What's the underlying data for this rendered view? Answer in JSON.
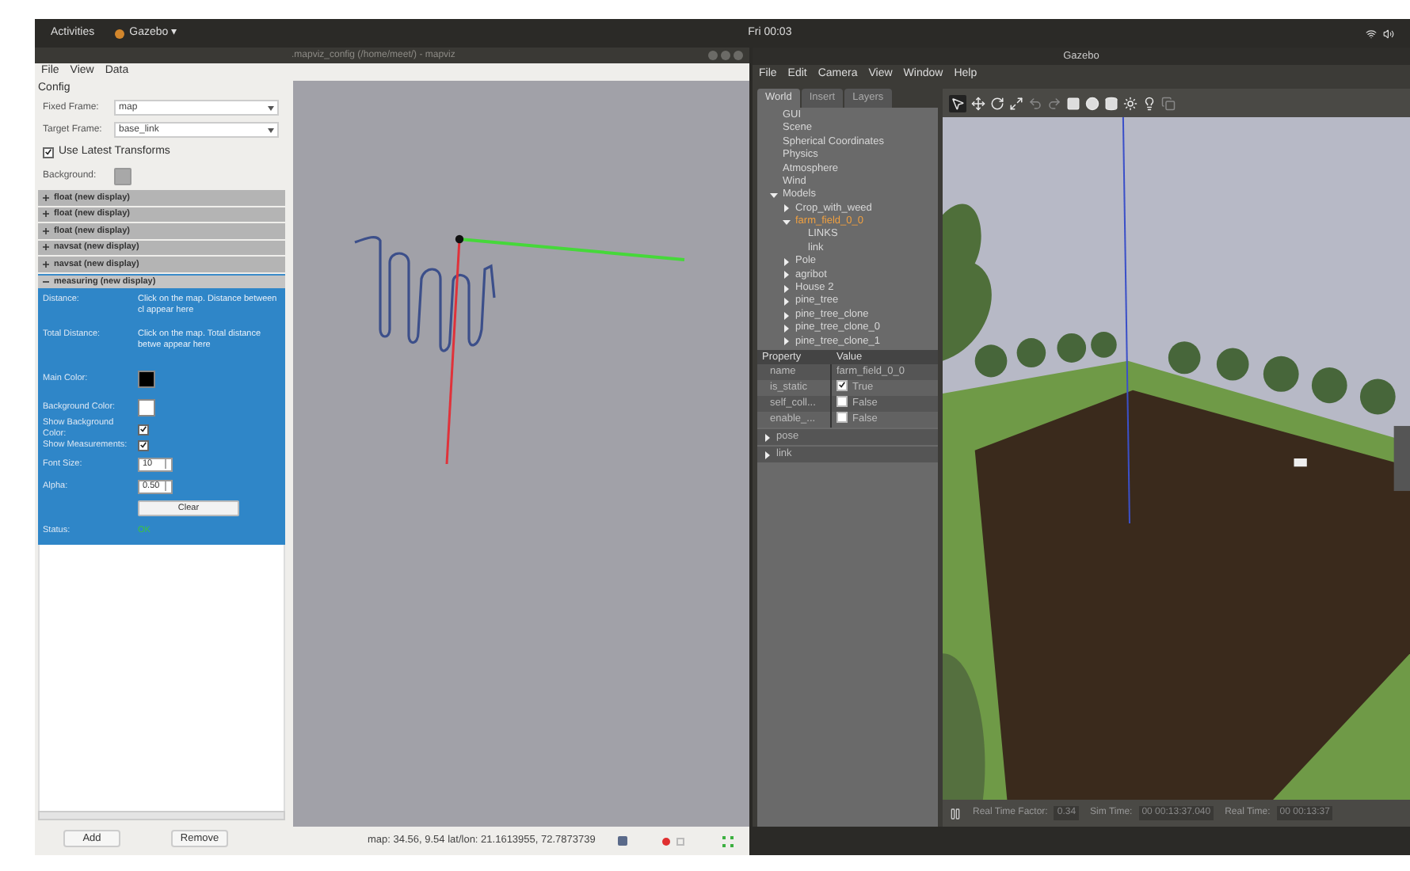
{
  "top_bar": {
    "activities": "Activities",
    "app_menu": "Gazebo ▾",
    "clock": "Fri 00:03"
  },
  "mapviz": {
    "title": ".mapviz_config (/home/meet/) - mapviz",
    "menu": [
      "File",
      "View",
      "Data"
    ],
    "config_label": "Config",
    "fields": [
      {
        "label": "Fixed Frame:",
        "value": "map"
      },
      {
        "label": "Target Frame:",
        "value": "base_link"
      }
    ],
    "use_latest_transforms": {
      "label": "Use Latest Transforms",
      "checked": true
    },
    "background_label": "Background:",
    "displays": [
      {
        "name": "float (new display)",
        "expanded": false
      },
      {
        "name": "float (new display)",
        "expanded": false
      },
      {
        "name": "float (new display)",
        "expanded": false
      },
      {
        "name": "navsat (new display)",
        "expanded": false
      },
      {
        "name": "navsat (new display)",
        "expanded": false
      },
      {
        "name": "measuring (new display)",
        "expanded": true
      }
    ],
    "measuring": [
      {
        "kind": "text",
        "label": "Distance:",
        "value": "Click on the map. Distance between cl appear here"
      },
      {
        "kind": "text",
        "label": "Total Distance:",
        "value": "Click on the map. Total distance betwe appear here"
      },
      {
        "kind": "color",
        "label": "Main Color:",
        "color": "#000000"
      },
      {
        "kind": "color",
        "label": "Background Color:",
        "color": "#ffffff"
      },
      {
        "kind": "checkbox",
        "label": "Show Background Color:",
        "checked": true
      },
      {
        "kind": "checkbox",
        "label": "Show Measurements:",
        "checked": true
      },
      {
        "kind": "spin",
        "label": "Font Size:",
        "value": "10"
      },
      {
        "kind": "spin",
        "label": "Alpha:",
        "value": "0.50"
      },
      {
        "kind": "button",
        "value": "Clear"
      },
      {
        "kind": "status",
        "label": "Status:",
        "value": "OK"
      }
    ],
    "buttons": [
      "Add",
      "Remove"
    ],
    "status": "map: 34.56, 9.54 lat/lon: 21.1613955, 72.7873739"
  },
  "gazebo": {
    "title": "Gazebo",
    "menu": [
      "File",
      "Edit",
      "Camera",
      "View",
      "Window",
      "Help"
    ],
    "tabs": [
      {
        "label": "World",
        "selected": true
      },
      {
        "label": "Insert",
        "selected": false
      },
      {
        "label": "Layers",
        "selected": false
      }
    ],
    "tree": [
      {
        "label": "GUI",
        "selected": false
      },
      {
        "label": "Scene",
        "selected": false
      },
      {
        "label": "Spherical Coordinates",
        "selected": false
      },
      {
        "label": "Physics",
        "selected": false
      },
      {
        "label": "Atmosphere",
        "selected": false
      },
      {
        "label": "Wind",
        "selected": false
      },
      {
        "label": "Models",
        "selected": false,
        "expanded": true,
        "children": [
          {
            "label": "Crop_with_weed",
            "selected": false,
            "expanded": false
          },
          {
            "label": "farm_field_0_0",
            "selected": true,
            "expanded": true,
            "children": [
              {
                "label": "LINKS",
                "selected": false
              },
              {
                "label": "link",
                "selected": false
              }
            ]
          },
          {
            "label": "Pole",
            "selected": false,
            "expanded": false
          },
          {
            "label": "agribot",
            "selected": false,
            "expanded": false
          },
          {
            "label": "House 2",
            "selected": false,
            "expanded": false
          },
          {
            "label": "pine_tree",
            "selected": false,
            "expanded": false
          },
          {
            "label": "pine_tree_clone",
            "selected": false,
            "expanded": false
          },
          {
            "label": "pine_tree_clone_0",
            "selected": false,
            "expanded": false
          },
          {
            "label": "pine_tree_clone_1",
            "selected": false,
            "expanded": false
          }
        ]
      }
    ],
    "property_headers": [
      "Property",
      "Value"
    ],
    "properties": [
      {
        "kind": "text",
        "name": "name",
        "value": "farm_field_0_0"
      },
      {
        "kind": "checkbox",
        "name": "is_static",
        "checked": true,
        "value": "True"
      },
      {
        "kind": "checkbox",
        "name": "self_coll...",
        "checked": false,
        "value": "False"
      },
      {
        "kind": "checkbox",
        "name": "enable_...",
        "checked": false,
        "value": "False"
      }
    ],
    "groups": [
      "pose",
      "link"
    ],
    "footer": [
      {
        "label": "Real Time Factor:",
        "value": "0.34"
      },
      {
        "label": "Sim Time:",
        "value": "00 00:13:37.040"
      },
      {
        "label": "Real Time:",
        "value": "00 00:13:37"
      }
    ]
  }
}
